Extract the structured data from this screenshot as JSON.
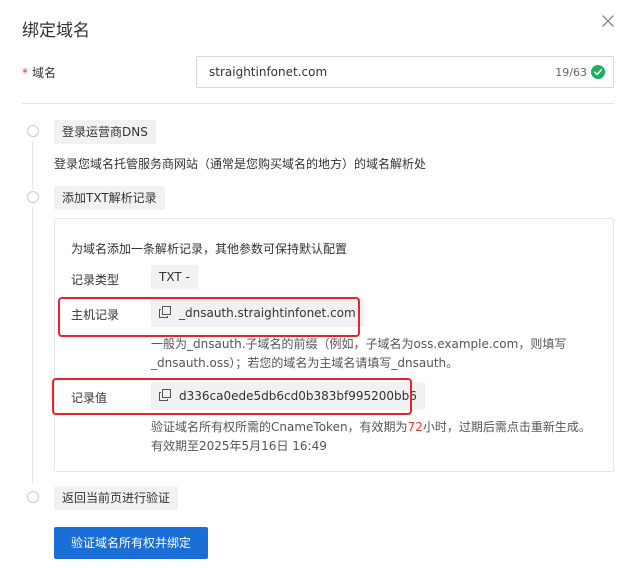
{
  "dialog": {
    "title": "绑定域名"
  },
  "domain_field": {
    "label": "域名",
    "required_mark": "*",
    "value": "straightinfonet.com",
    "counter": "19/63"
  },
  "steps": [
    {
      "tag": "登录运营商DNS",
      "description": "登录您域名托管服务商网站（通常是您购买域名的地方）的域名解析处"
    },
    {
      "tag": "添加TXT解析记录",
      "panel": {
        "intro": "为域名添加一条解析记录，其他参数可保持默认配置",
        "record_type_label": "记录类型",
        "record_type_value": "TXT -",
        "host_label": "主机记录",
        "host_value": "_dnsauth.straightinfonet.com",
        "host_hint_line1": "一般为_dnsauth.子域名的前缀（例如，子域名为oss.example.com，则填写",
        "host_hint_line2": "_dnsauth.oss）；若您的域名为主域名请填写_dnsauth。",
        "record_value_label": "记录值",
        "record_value": "d336ca0ede5db6cd0b383bf995200bb6",
        "token_hint_prefix": "验证域名所有权所需的CnameToken，有效期为",
        "token_hint_hours": "72",
        "token_hint_suffix": "小时，过期后需点击重新生成。",
        "expiry": "有效期至2025年5月16日 16:49"
      }
    },
    {
      "tag": "返回当前页进行验证"
    }
  ],
  "submit_label": "验证域名所有权并绑定",
  "colors": {
    "primary": "#1a6ed8",
    "success": "#1ab15d",
    "highlight_frame": "#e8232a",
    "required": "#e23c39"
  }
}
